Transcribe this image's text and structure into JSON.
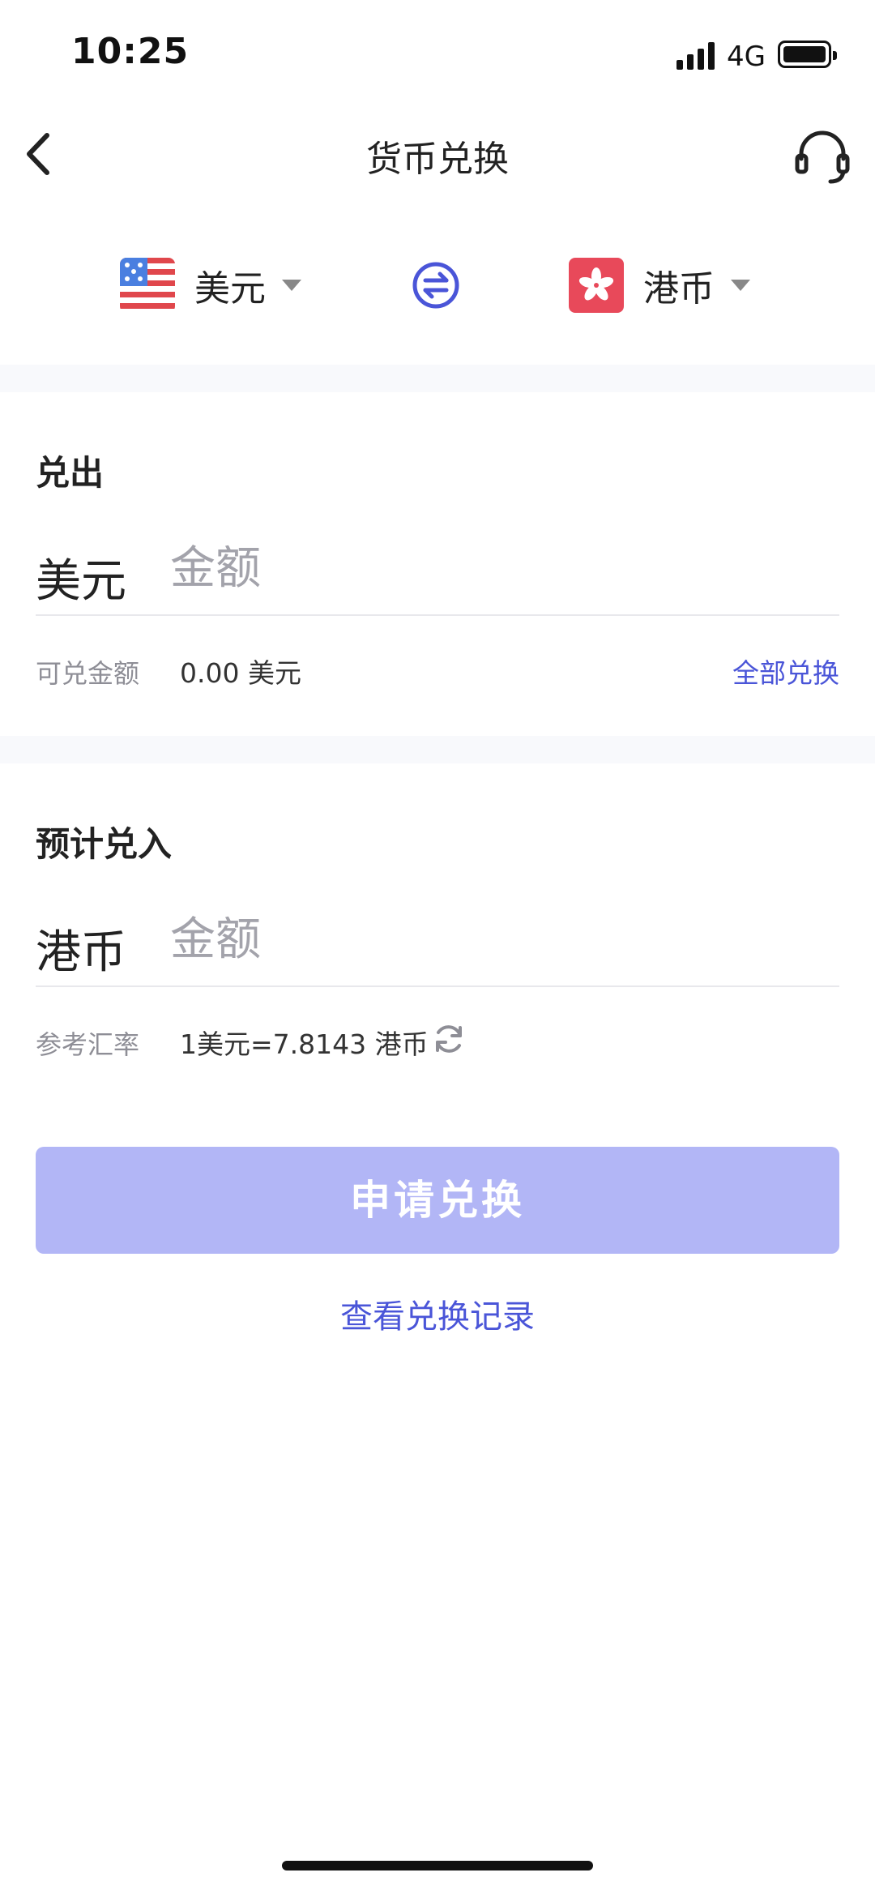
{
  "status_bar": {
    "time": "10:25",
    "network": "4G"
  },
  "nav": {
    "title": "货币兑换",
    "back_icon": "chevron-left-icon",
    "support_icon": "headset-icon"
  },
  "currency_selector": {
    "from": {
      "label": "美元",
      "flag_icon": "us-flag-icon"
    },
    "to": {
      "label": "港币",
      "flag_icon": "hk-flag-icon"
    },
    "swap_icon": "swap-icon",
    "dropdown_icon": "caret-down-icon"
  },
  "sell": {
    "title": "兑出",
    "currency": "美元",
    "placeholder": "金额",
    "available_label": "可兑金额",
    "available_value": "0.00 美元",
    "all_link": "全部兑换"
  },
  "buy": {
    "title": "预计兑入",
    "currency": "港币",
    "placeholder": "金额",
    "rate_label": "参考汇率",
    "rate_value": "1美元=7.8143 港币",
    "refresh_icon": "refresh-icon"
  },
  "actions": {
    "submit": "申请兑换",
    "history": "查看兑换记录"
  },
  "colors": {
    "accent": "#4a55d8",
    "button_disabled": "#b2b6f6",
    "us_red": "#e0474c",
    "hk_red": "#e8495a"
  }
}
